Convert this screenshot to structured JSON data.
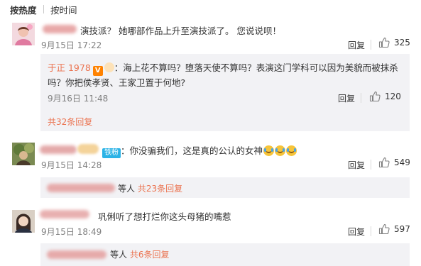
{
  "tabs": {
    "hot": "按热度",
    "time": "按时间"
  },
  "comments": [
    {
      "text": "演技派？ 她哪部作品上升至演技派了。 您说说呗！",
      "date": "9月15日 17:22",
      "reply_label": "回复",
      "likes": "325",
      "reply": {
        "author": "于正 1978",
        "text_line1": "：海上花不算吗？堕落天使不算吗？表演这门学科可以因为美貌而被抹杀",
        "text_line2": "吗？你把侯孝贤、王家卫置于何地?",
        "date": "9月16日 11:48",
        "reply_label": "回复",
        "likes": "120",
        "more": "共32条回复"
      }
    },
    {
      "badge": "铁粉",
      "text": "：你没骗我们，这是真的公认的女神",
      "date": "9月15日 14:28",
      "reply_label": "回复",
      "likes": "549",
      "summary_prefix": "等人",
      "summary_link": "共23条回复"
    },
    {
      "text": "巩俐听了想打烂你这头母猪的嘴惹",
      "date": "9月15日 18:49",
      "reply_label": "回复",
      "likes": "597",
      "summary_prefix": "等人",
      "summary_link": "共6条回复"
    }
  ],
  "colors": {
    "accent": "#eb7350",
    "reply_bg": "#f2f2f5",
    "meta": "#808080",
    "verified": "#ff8200",
    "fan_badge": "#2bb3e6"
  },
  "icons": {
    "like": "thumbs-up-icon",
    "verified": "verified-v-icon"
  }
}
